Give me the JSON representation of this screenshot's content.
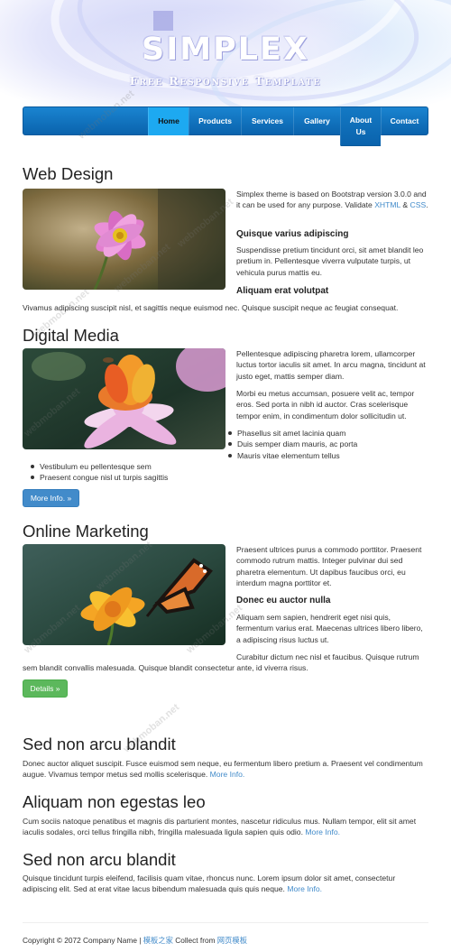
{
  "header": {
    "logo": "SIMPLEX",
    "tagline": "Free Responsive Template"
  },
  "nav": {
    "items": [
      {
        "label": "Home",
        "active": true
      },
      {
        "label": "Products"
      },
      {
        "label": "Services"
      },
      {
        "label": "Gallery"
      },
      {
        "label_line1": "About",
        "label_line2": "Us"
      },
      {
        "label": "Contact"
      }
    ]
  },
  "sections": {
    "web_design": {
      "title": "Web Design",
      "intro_pre": "Simplex theme is based on Bootstrap version 3.0.0 and it can be used for any purpose. Validate ",
      "xhtml_link": "XHTML",
      "amp": " & ",
      "css_link": "CSS",
      "period": ".",
      "subheading_1": "Quisque varius adipiscing",
      "para_1": "Suspendisse pretium tincidunt orci, sit amet blandit leo pretium in. Pellentesque viverra vulputate turpis, ut vehicula purus mattis eu.",
      "subheading_2": "Aliquam erat volutpat",
      "para_2": "Vivamus adipiscing suscipit nisl, et sagittis neque euismod nec. Quisque suscipit neque ac feugiat consequat."
    },
    "digital_media": {
      "title": "Digital Media",
      "para_1": "Pellentesque adipiscing pharetra lorem, ullamcorper luctus tortor iaculis sit amet. In arcu magna, tincidunt at justo eget, mattis semper diam.",
      "para_2": "Morbi eu metus accumsan, posuere velit ac, tempor eros. Sed porta in nibh id auctor. Cras scelerisque tempor enim, in condimentum dolor sollicitudin ut.",
      "bullets": [
        "Phasellus sit amet lacinia quam",
        "Duis semper diam mauris, ac porta",
        "Mauris vitae elementum tellus",
        "Vestibulum eu pellentesque sem",
        "Praesent congue nisl ut turpis sagittis"
      ],
      "button": "More Info. »"
    },
    "online_marketing": {
      "title": "Online Marketing",
      "para_1": "Praesent ultrices purus a commodo porttitor. Praesent commodo rutrum mattis. Integer pulvinar dui sed pharetra elementum. Ut dapibus faucibus orci, eu interdum magna porttitor et.",
      "subheading": "Donec eu auctor nulla",
      "para_2": "Aliquam sem sapien, hendrerit eget nisi quis, fermentum varius erat. Maecenas ultrices libero libero, a adipiscing risus luctus ut.",
      "para_3": "Curabitur dictum nec nisl et faucibus. Quisque rutrum sem blandit convallis malesuada. Quisque blandit consectetur ante, id viverra risus.",
      "button": "Details »"
    },
    "extra": [
      {
        "title": "Sed non arcu blandit",
        "text": "Donec auctor aliquet suscipit. Fusce euismod sem neque, eu fermentum libero pretium a. Praesent vel condimentum augue. Vivamus tempor metus sed mollis scelerisque. ",
        "link": "More Info."
      },
      {
        "title": "Aliquam non egestas leo",
        "text": "Cum sociis natoque penatibus et magnis dis parturient montes, nascetur ridiculus mus. Nullam tempor, elit sit amet iaculis sodales, orci tellus fringilla nibh, fringilla malesuada ligula sapien quis odio. ",
        "link": "More Info."
      },
      {
        "title": "Sed non arcu blandit",
        "text": "Quisque tincidunt turpis eleifend, facilisis quam vitae, rhoncus nunc. Lorem ipsum dolor sit amet, consectetur adipiscing elit. Sed at erat vitae lacus bibendum malesuada quis quis neque. ",
        "link": "More Info."
      }
    ]
  },
  "footer": {
    "copyright": "Copyright © 2072 Company Name | ",
    "link_1": "模板之家",
    "collect_text": " Collect from ",
    "link_2": "网页模板"
  },
  "watermark": "webmoban.net",
  "colors": {
    "nav": "#0a63ad",
    "nav_active": "#1da9f1",
    "link": "#428bca",
    "button_blue": "#428bca",
    "button_green": "#5cb85c"
  }
}
